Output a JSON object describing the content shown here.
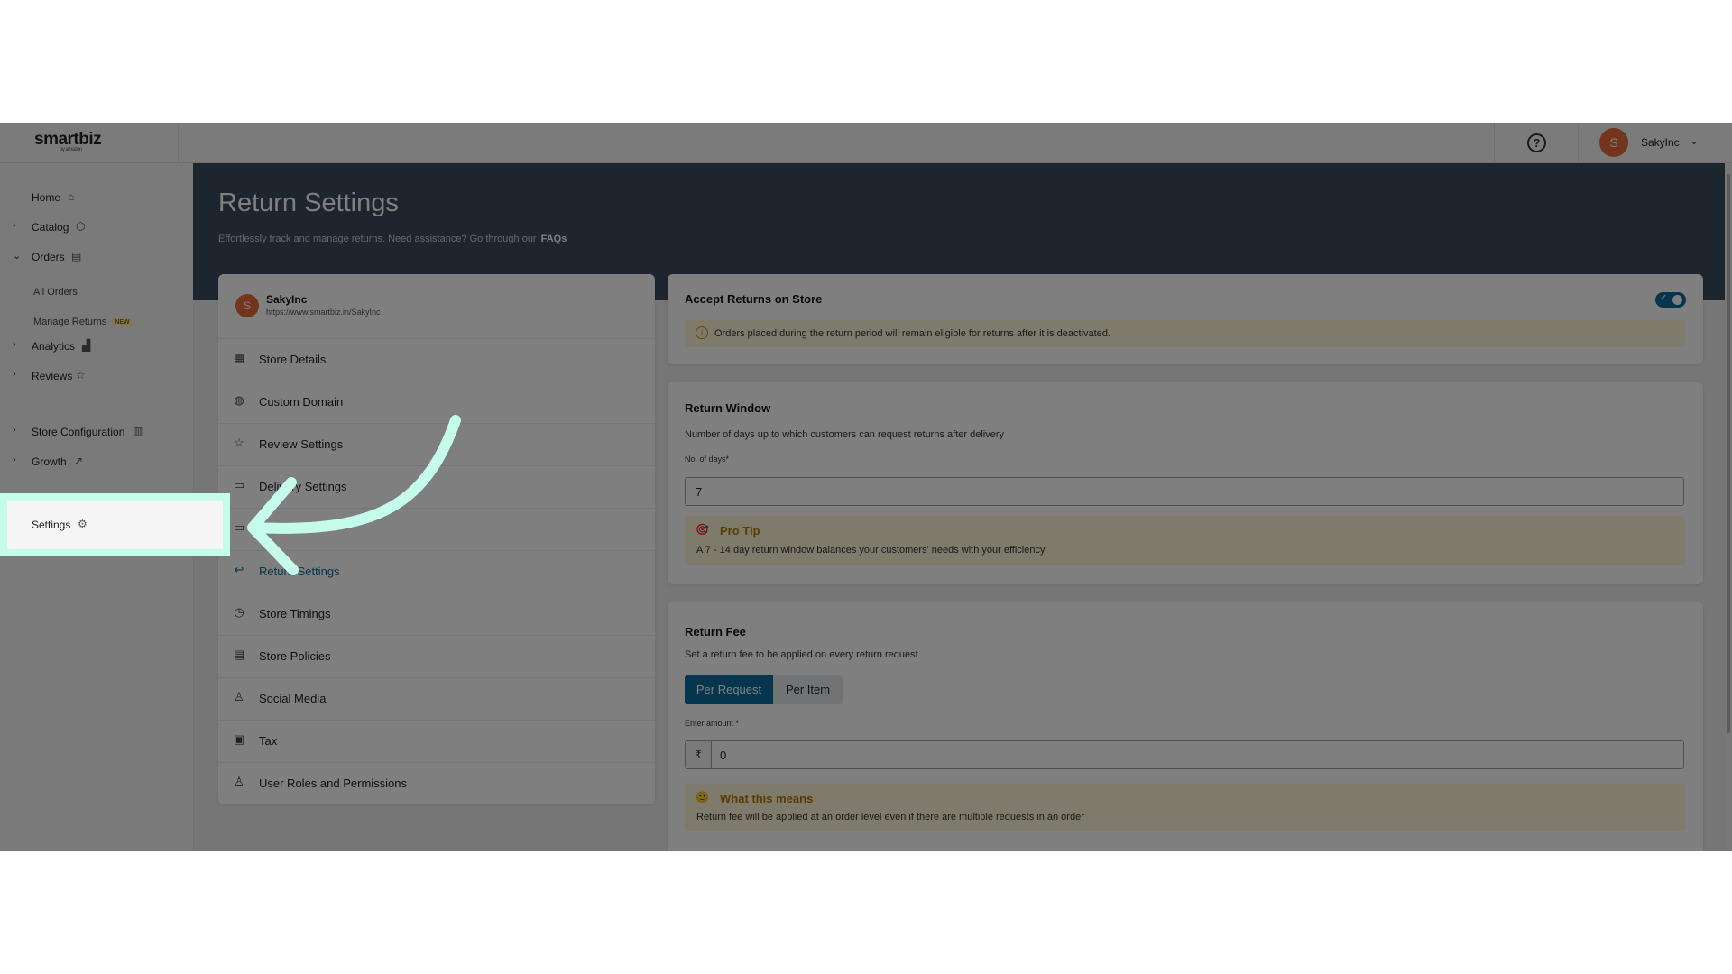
{
  "brand": {
    "logo_text": "smartbiz",
    "logo_sub": "by amazon"
  },
  "topbar": {
    "help_icon": "question-circle-icon",
    "avatar_letter": "S",
    "user_name": "SakyInc",
    "chevron": "⌄"
  },
  "sidebar": {
    "items": [
      {
        "label": "Home",
        "icon": "home-icon",
        "glyph": "⌂",
        "chevron": ""
      },
      {
        "label": "Catalog",
        "icon": "cube-icon",
        "glyph": "⬡",
        "chevron": "›"
      },
      {
        "label": "Orders",
        "icon": "clipboard-icon",
        "glyph": "▤",
        "chevron": "⌄"
      },
      {
        "label": "Analytics",
        "icon": "bar-chart-icon",
        "glyph": "▟",
        "chevron": "›"
      },
      {
        "label": "Reviews",
        "icon": "star-icon",
        "glyph": "☆",
        "chevron": "›"
      },
      {
        "label": "Store Configuration",
        "icon": "store-icon",
        "glyph": "▥",
        "chevron": "›"
      },
      {
        "label": "Growth",
        "icon": "trending-up-icon",
        "glyph": "↗",
        "chevron": "›"
      },
      {
        "label": "Settings",
        "icon": "gear-icon",
        "glyph": "⚙",
        "chevron": ""
      }
    ],
    "orders_sub": {
      "all_orders": "All Orders",
      "manage_returns": "Manage Returns",
      "new_badge": "NEW"
    }
  },
  "header": {
    "title": "Return Settings",
    "subtitle": "Effortlessly track and manage returns. Need assistance? Go through our",
    "faq_link": "FAQs"
  },
  "store": {
    "avatar_letter": "S",
    "name": "SakyInc",
    "url": "https://www.smartbiz.in/SakyInc"
  },
  "settings_nav": [
    {
      "label": "Store Details",
      "icon": "store-icon",
      "glyph": "▦"
    },
    {
      "label": "Custom Domain",
      "icon": "globe-icon",
      "glyph": "◍"
    },
    {
      "label": "Review Settings",
      "icon": "star-icon",
      "glyph": "☆"
    },
    {
      "label": "Delivery Settings",
      "icon": "truck-icon",
      "glyph": "▭"
    },
    {
      "label": "",
      "icon": "payment-icon",
      "glyph": "▭"
    },
    {
      "label": "Return Settings",
      "icon": "return-arrow-icon",
      "glyph": "↩"
    },
    {
      "label": "Store Timings",
      "icon": "clock-icon",
      "glyph": "◷"
    },
    {
      "label": "Store Policies",
      "icon": "document-icon",
      "glyph": "▤"
    },
    {
      "label": "Social Media",
      "icon": "person-icon",
      "glyph": "♙"
    },
    {
      "label": "Tax",
      "icon": "calculator-icon",
      "glyph": "▣"
    },
    {
      "label": "User Roles and Permissions",
      "icon": "users-icon",
      "glyph": "♙"
    }
  ],
  "accept_returns": {
    "title": "Accept Returns on Store",
    "enabled": true,
    "notice": "Orders placed during the return period will remain eligible for returns after it is deactivated."
  },
  "return_window": {
    "title": "Return Window",
    "description": "Number of days up to which customers can request returns after delivery",
    "field_label": "No. of days*",
    "value": "7",
    "tip_title": "Pro Tip",
    "tip_text": "A 7 - 14 day return window balances your customers' needs with your efficiency"
  },
  "return_fee": {
    "title": "Return Fee",
    "description": "Set a return fee to be applied on every return request",
    "options": [
      "Per Request",
      "Per Item"
    ],
    "selected": "Per Request",
    "amount_label": "Enter amount *",
    "currency": "₹",
    "amount": "0",
    "info_title": "What this means",
    "info_text": "Return fee will be applied at an order level even if there are multiple requests in an order"
  },
  "colors": {
    "accent": "#0a6c9a",
    "header_bg": "#3b4b5e",
    "highlight": "#c4fbeb",
    "tip_bg": "#fdf5d8",
    "avatar": "#e86a3b"
  }
}
